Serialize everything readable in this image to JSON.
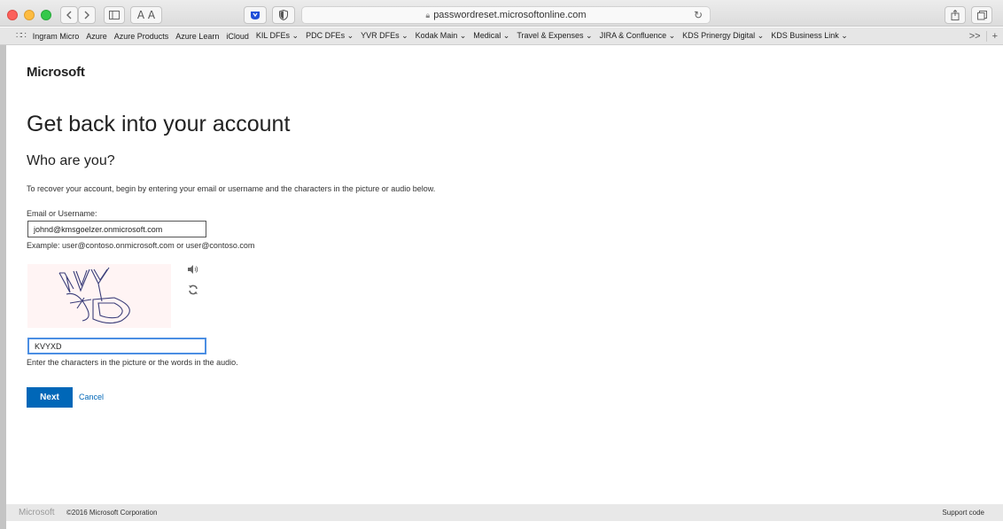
{
  "browser": {
    "url": "passwordreset.microsoftonline.com",
    "text_size_label": "A A",
    "bookmarks": [
      "Ingram Micro",
      "Azure",
      "Azure Products",
      "Azure Learn",
      "iCloud",
      "KIL DFEs ⌄",
      "PDC DFEs ⌄",
      "YVR DFEs ⌄",
      "Kodak Main ⌄",
      "Medical ⌄",
      "Travel & Expenses ⌄",
      "JIRA & Confluence ⌄",
      "KDS Prinergy Digital ⌄",
      "KDS Business Link ⌄"
    ],
    "bookmarks_more": ">>",
    "new_tab": "+"
  },
  "page": {
    "brand": "Microsoft",
    "title": "Get back into your account",
    "subtitle": "Who are you?",
    "instructions": "To recover your account, begin by entering your email or username and the characters in the picture or audio below.",
    "email_label": "Email or Username:",
    "email_value": "johnd@kmsgoelzer.onmicrosoft.com",
    "email_example": "Example: user@contoso.onmicrosoft.com or user@contoso.com",
    "captcha_text": "KVYXD",
    "captcha_value": "KVYXD",
    "captcha_hint": "Enter the characters in the picture or the words in the audio.",
    "next_label": "Next",
    "cancel_label": "Cancel"
  },
  "footer": {
    "brand": "Microsoft",
    "copyright": "©2016 Microsoft Corporation",
    "support": "Support code"
  },
  "colors": {
    "accent": "#0067b8",
    "focus": "#4b8ee3"
  },
  "icons": [
    "audio-icon",
    "refresh-icon",
    "lock-icon",
    "reload-icon",
    "sidebar-icon",
    "share-icon",
    "tabs-icon",
    "shield-icon",
    "extension-icon"
  ]
}
